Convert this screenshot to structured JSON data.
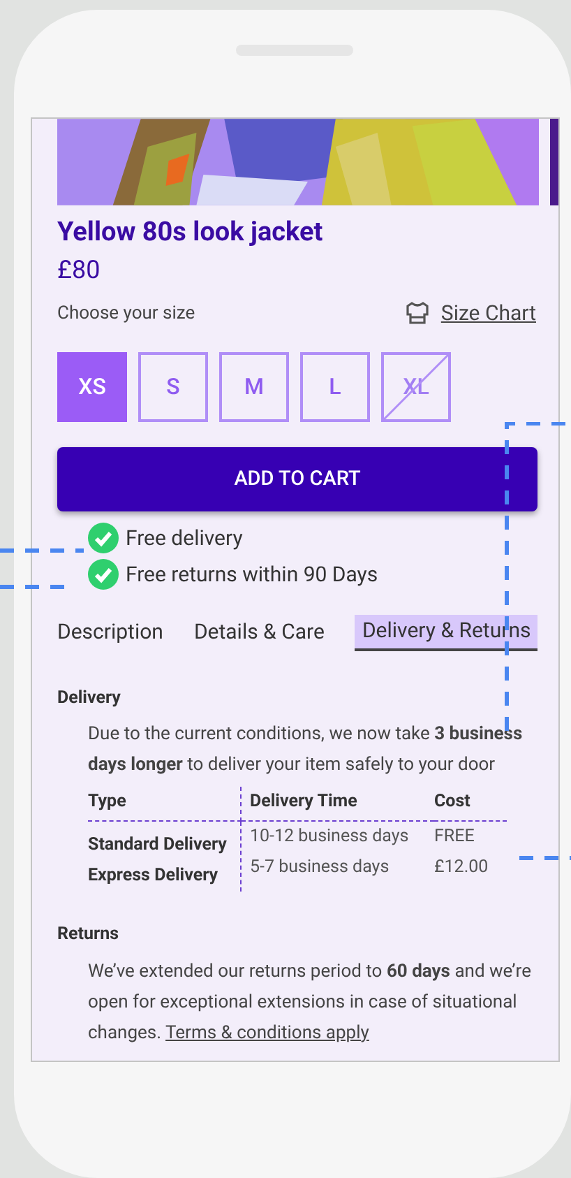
{
  "product": {
    "title": "Yellow 80s look jacket",
    "price": "£80"
  },
  "size_picker": {
    "label": "Choose your size",
    "chart_link": "Size Chart",
    "sizes": [
      {
        "label": "XS",
        "selected": true,
        "available": true
      },
      {
        "label": "S",
        "selected": false,
        "available": true
      },
      {
        "label": "M",
        "selected": false,
        "available": true
      },
      {
        "label": "L",
        "selected": false,
        "available": true
      },
      {
        "label": "XL",
        "selected": false,
        "available": false
      }
    ]
  },
  "add_to_cart": "ADD TO CART",
  "perks": [
    "Free delivery",
    "Free returns within 90 Days"
  ],
  "tabs": [
    {
      "label": "Description",
      "selected": false
    },
    {
      "label": "Details & Care",
      "selected": false
    },
    {
      "label": "Delivery & Returns",
      "selected": true
    }
  ],
  "delivery": {
    "heading": "Delivery",
    "text": "Due to the current conditions, we now take **3 business days longer** to deliver your item safely to your door",
    "table": {
      "columns": [
        "Type",
        "Delivery Time",
        "Cost"
      ],
      "rows": [
        {
          "type": "Standard Delivery",
          "time": "10-12 business days",
          "cost": "FREE"
        },
        {
          "type": "Express Delivery",
          "time": "5-7 business days",
          "cost": "£12.00"
        }
      ]
    }
  },
  "returns": {
    "heading": "Returns",
    "text": "We’ve extended our returns period to **60 days** and we’re open for exceptional extensions in case of situational changes.",
    "link": "Terms & conditions apply"
  }
}
